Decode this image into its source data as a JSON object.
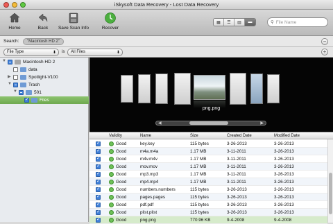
{
  "window": {
    "title": "iSkysoft Data Recovery - Lost Data Recovery"
  },
  "toolbar": {
    "home_label": "Home",
    "back_label": "Back",
    "save_label": "Save Scan Info",
    "recover_label": "Recover",
    "search_placeholder": "File Name"
  },
  "searchbar": {
    "label": "Search:",
    "chip": "\"Macintosh HD 2\""
  },
  "filter": {
    "type_value": "File Type",
    "is_label": "is",
    "files_value": "All Files"
  },
  "sidebar": {
    "items": [
      {
        "label": "Macintosh HD 2"
      },
      {
        "label": "data"
      },
      {
        "label": "Spotlight-V100"
      },
      {
        "label": "Trash"
      },
      {
        "label": "501"
      },
      {
        "label": "Files"
      }
    ]
  },
  "preview": {
    "name": "png.png"
  },
  "table": {
    "headers": [
      "Validity",
      "Name",
      "Size",
      "Created Date",
      "Modified Date"
    ],
    "rows": [
      {
        "validity": "Good",
        "name": "key.key",
        "size": "115 bytes",
        "created": "3-26-2013",
        "modified": "3-26-2013"
      },
      {
        "validity": "Good",
        "name": "m4a.m4a",
        "size": "1.17 MB",
        "created": "3-11-2011",
        "modified": "3-26-2013"
      },
      {
        "validity": "Good",
        "name": "m4v.m4v",
        "size": "1.17 MB",
        "created": "3-11-2011",
        "modified": "3-26-2013"
      },
      {
        "validity": "Good",
        "name": "mov.mov",
        "size": "1.17 MB",
        "created": "3-11-2011",
        "modified": "3-26-2013"
      },
      {
        "validity": "Good",
        "name": "mp3.mp3",
        "size": "1.17 MB",
        "created": "3-11-2011",
        "modified": "3-26-2013"
      },
      {
        "validity": "Good",
        "name": "mp4.mp4",
        "size": "1.17 MB",
        "created": "3-11-2011",
        "modified": "3-26-2013"
      },
      {
        "validity": "Good",
        "name": "numbers.numbers",
        "size": "115 bytes",
        "created": "3-26-2013",
        "modified": "3-26-2013"
      },
      {
        "validity": "Good",
        "name": "pages.pages",
        "size": "115 bytes",
        "created": "3-26-2013",
        "modified": "3-26-2013"
      },
      {
        "validity": "Good",
        "name": "pdf.pdf",
        "size": "115 bytes",
        "created": "3-26-2013",
        "modified": "3-26-2013"
      },
      {
        "validity": "Good",
        "name": "plist.plist",
        "size": "115 bytes",
        "created": "3-26-2013",
        "modified": "3-26-2013"
      },
      {
        "validity": "Good",
        "name": "png.png",
        "size": "770.96 KB",
        "created": "9-4-2008",
        "modified": "9-4-2008"
      }
    ]
  }
}
